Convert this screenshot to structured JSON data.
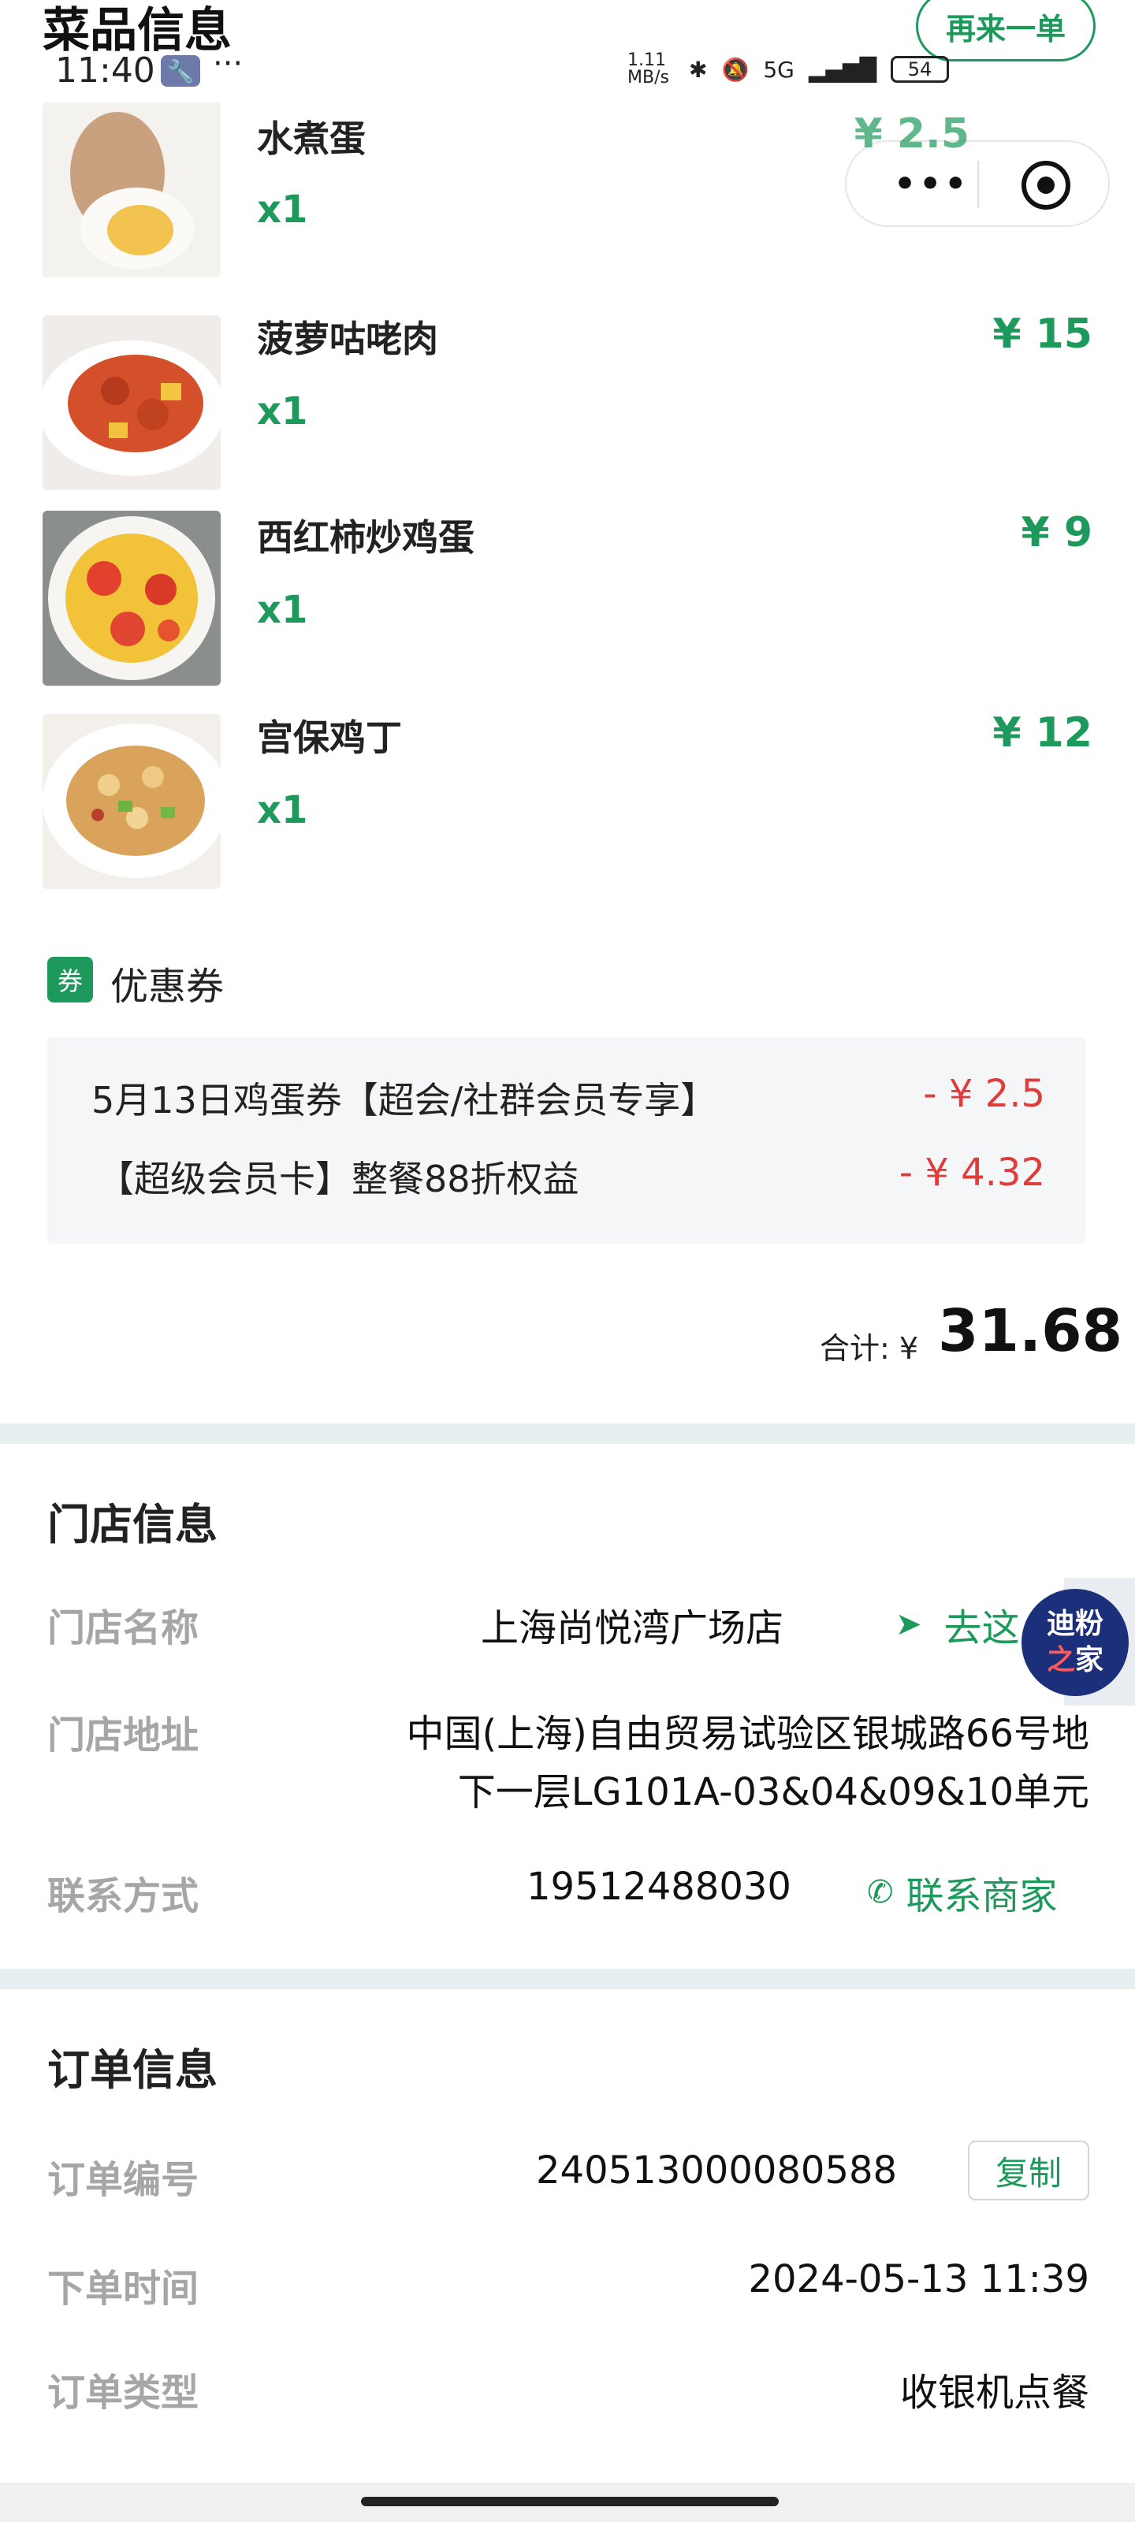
{
  "header": {
    "title": "菜品信息",
    "reorder_label": "再来一单"
  },
  "status_bar": {
    "time": "11:40",
    "dots": "···",
    "network_speed": "1.11 MB/s",
    "signal": "5G",
    "battery": "54"
  },
  "dishes": [
    {
      "name": "水煮蛋",
      "qty": "x1",
      "price": "¥ 2.5"
    },
    {
      "name": "菠萝咕咾肉",
      "qty": "x1",
      "price": "¥ 15"
    },
    {
      "name": "西红柿炒鸡蛋",
      "qty": "x1",
      "price": "¥ 9"
    },
    {
      "name": "宫保鸡丁",
      "qty": "x1",
      "price": "¥ 12"
    }
  ],
  "coupons": {
    "icon_label": "券",
    "title": "优惠券",
    "items": [
      {
        "label": "5月13日鸡蛋券【超会/社群会员专享】",
        "amount": "- ¥ 2.5"
      },
      {
        "label": "【超级会员卡】整餐88折权益",
        "amount": "- ¥ 4.32"
      }
    ]
  },
  "total": {
    "label": "合计: ¥",
    "value": "31.68"
  },
  "store": {
    "section_title": "门店信息",
    "name_label": "门店名称",
    "name_value": "上海尚悦湾广场店",
    "nav_label": "去这",
    "address_label": "门店地址",
    "address_line1": "中国(上海)自由贸易试验区银城路66号地",
    "address_line2": "下一层LG101A-03&04&09&10单元",
    "contact_label": "联系方式",
    "contact_value": "19512488030",
    "contact_link": "联系商家"
  },
  "badge": {
    "line1": "迪粉",
    "line2a": "之",
    "line2b": "家"
  },
  "order": {
    "section_title": "订单信息",
    "number_label": "订单编号",
    "number_value": "240513000080588",
    "copy_label": "复制",
    "time_label": "下单时间",
    "time_value": "2024-05-13 11:39",
    "type_label": "订单类型",
    "type_value": "收银机点餐"
  },
  "colors": {
    "accent_green": "#1d9a5b",
    "discount_red": "#e03c3c",
    "label_gray": "#a6a6a6",
    "divider": "#e8eff0"
  }
}
